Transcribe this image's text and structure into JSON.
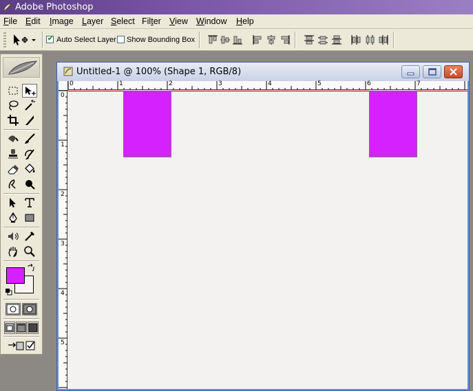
{
  "app": {
    "title": "Adobe Photoshop"
  },
  "menu": [
    {
      "label": "File",
      "mnemonic_index": 0
    },
    {
      "label": "Edit",
      "mnemonic_index": 0
    },
    {
      "label": "Image",
      "mnemonic_index": 0
    },
    {
      "label": "Layer",
      "mnemonic_index": 0
    },
    {
      "label": "Select",
      "mnemonic_index": 0
    },
    {
      "label": "Filter",
      "mnemonic_index": 3
    },
    {
      "label": "View",
      "mnemonic_index": 0
    },
    {
      "label": "Window",
      "mnemonic_index": 0
    },
    {
      "label": "Help",
      "mnemonic_index": 0
    }
  ],
  "options": {
    "auto_select_label": "Auto Select Layer",
    "auto_select_checked": true,
    "bounding_box_label": "Show Bounding Box",
    "bounding_box_checked": false,
    "align_icons": [
      "align-top-edges-icon",
      "align-vertical-centers-icon",
      "align-bottom-edges-icon",
      "align-left-edges-icon",
      "align-horizontal-centers-icon",
      "align-right-edges-icon",
      "distribute-top-icon",
      "distribute-vertical-centers-icon",
      "distribute-bottom-icon",
      "distribute-left-icon",
      "distribute-horizontal-centers-icon",
      "distribute-right-icon"
    ]
  },
  "toolbox": {
    "active_tool": "move-tool",
    "foreground_color": "#d621ff",
    "background_color": "#f7f5f0"
  },
  "document": {
    "title": "Untitled-1 @ 100% (Shape 1, RGB/8)",
    "ruler_h_labels": [
      "0",
      "1",
      "2",
      "3",
      "4",
      "5",
      "6",
      "7"
    ],
    "ruler_v_labels": [
      "0",
      "1",
      "2",
      "3",
      "4",
      "5"
    ],
    "canvas_color": "#f4f2f0",
    "shape_color": "#d621ff"
  }
}
